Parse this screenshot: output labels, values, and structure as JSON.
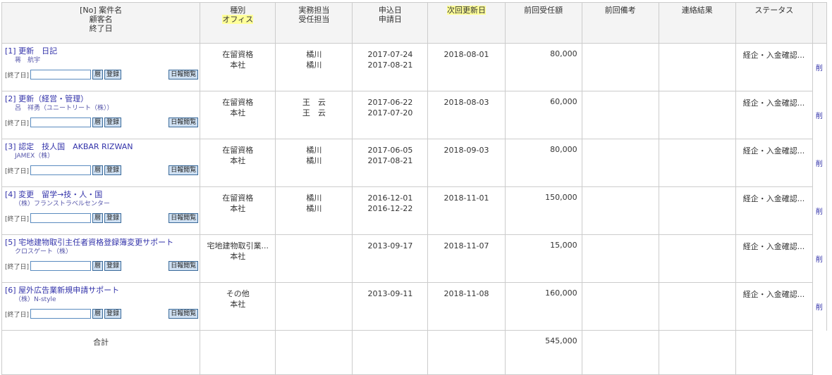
{
  "headers": {
    "case": [
      "[No] 案件名",
      "顧客名",
      "終了日"
    ],
    "type": [
      "種別",
      "オフィス"
    ],
    "staff": [
      "実務担当",
      "受任担当"
    ],
    "dates": [
      "申込日",
      "申請日"
    ],
    "next_update": "次回更新日",
    "last_fee": "前回受任額",
    "last_note": "前回備考",
    "contact": "連絡結果",
    "status": "ステータス"
  },
  "controls": {
    "end_date_label": "[終了日]",
    "calendar_button": "暦",
    "register_button": "登録",
    "daily_report_button": "日報閲覧",
    "delete_label": "削"
  },
  "rows": [
    {
      "no": "[1]",
      "title": "更新　日記",
      "client": "蒋　航宇",
      "type": "在留資格",
      "office": "本社",
      "staff1": "橘川",
      "staff2": "橘川",
      "date1": "2017-07-24",
      "date2": "2017-08-21",
      "next": "2018-08-01",
      "fee": "80,000",
      "note": "",
      "contact": "",
      "status": "経企・入金確認..."
    },
    {
      "no": "[2]",
      "title": "更新（経営・管理）",
      "client": "呂　祥勇（ユニートリート（株））",
      "type": "在留資格",
      "office": "本社",
      "staff1": "王　云",
      "staff2": "王　云",
      "date1": "2017-06-22",
      "date2": "2017-07-20",
      "next": "2018-08-03",
      "fee": "60,000",
      "note": "",
      "contact": "",
      "status": "経企・入金確認..."
    },
    {
      "no": "[3]",
      "title": "認定　技人国　AKBAR RIZWAN",
      "client": "JAMEX（株）",
      "type": "在留資格",
      "office": "本社",
      "staff1": "橘川",
      "staff2": "橘川",
      "date1": "2017-06-05",
      "date2": "2017-08-21",
      "next": "2018-09-03",
      "fee": "80,000",
      "note": "",
      "contact": "",
      "status": "経企・入金確認..."
    },
    {
      "no": "[4]",
      "title": "変更　留学→技・人・国",
      "client": "（株）フランストラベルセンター",
      "type": "在留資格",
      "office": "本社",
      "staff1": "橘川",
      "staff2": "橘川",
      "date1": "2016-12-01",
      "date2": "2016-12-22",
      "next": "2018-11-01",
      "fee": "150,000",
      "note": "",
      "contact": "",
      "status": "経企・入金確認..."
    },
    {
      "no": "[5]",
      "title": "宅地建物取引主任者資格登録簿変更サポート",
      "client": "クロスゲート（株）",
      "type": "宅地建物取引業...",
      "office": "本社",
      "staff1": "",
      "staff2": "",
      "date1": "2013-09-17",
      "date2": "",
      "next": "2018-11-07",
      "fee": "15,000",
      "note": "",
      "contact": "",
      "status": "経企・入金確認..."
    },
    {
      "no": "[6]",
      "title": "屋外広告業新規申請サポート",
      "client": "（株）N-style",
      "type": "その他",
      "office": "本社",
      "staff1": "",
      "staff2": "",
      "date1": "2013-09-11",
      "date2": "",
      "next": "2018-11-08",
      "fee": "160,000",
      "note": "",
      "contact": "",
      "status": "経企・入金確認..."
    }
  ],
  "total": {
    "label": "合計",
    "fee": "545,000"
  }
}
